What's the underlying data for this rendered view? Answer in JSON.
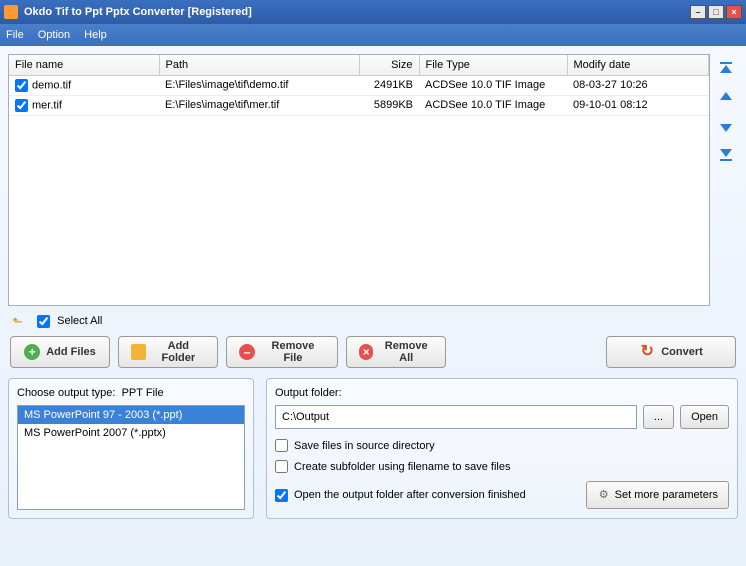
{
  "window": {
    "title": "Okdo Tif to Ppt Pptx Converter [Registered]"
  },
  "menu": {
    "file": "File",
    "option": "Option",
    "help": "Help"
  },
  "table": {
    "headers": {
      "filename": "File name",
      "path": "Path",
      "size": "Size",
      "filetype": "File Type",
      "modify": "Modify date"
    },
    "rows": [
      {
        "checked": true,
        "name": "demo.tif",
        "path": "E:\\Files\\image\\tif\\demo.tif",
        "size": "2491KB",
        "type": "ACDSee 10.0 TIF Image",
        "modify": "08-03-27 10:26"
      },
      {
        "checked": true,
        "name": "mer.tif",
        "path": "E:\\Files\\image\\tif\\mer.tif",
        "size": "5899KB",
        "type": "ACDSee 10.0 TIF Image",
        "modify": "09-10-01 08:12"
      }
    ]
  },
  "selectall": {
    "label": "Select All",
    "checked": true
  },
  "buttons": {
    "add_files": "Add Files",
    "add_folder": "Add Folder",
    "remove_file": "Remove File",
    "remove_all": "Remove All",
    "convert": "Convert"
  },
  "output_type": {
    "label_prefix": "Choose output type:",
    "current": "PPT File",
    "options": [
      {
        "label": "MS PowerPoint 97 - 2003 (*.ppt)",
        "selected": true
      },
      {
        "label": "MS PowerPoint 2007 (*.pptx)",
        "selected": false
      }
    ]
  },
  "output_folder": {
    "label": "Output folder:",
    "value": "C:\\Output",
    "browse": "...",
    "open": "Open"
  },
  "options": {
    "save_source": {
      "label": "Save files in source directory",
      "checked": false
    },
    "subfolder": {
      "label": "Create subfolder using filename to save files",
      "checked": false
    },
    "open_after": {
      "label": "Open the output folder after conversion finished",
      "checked": true
    }
  },
  "set_more": "Set more parameters"
}
